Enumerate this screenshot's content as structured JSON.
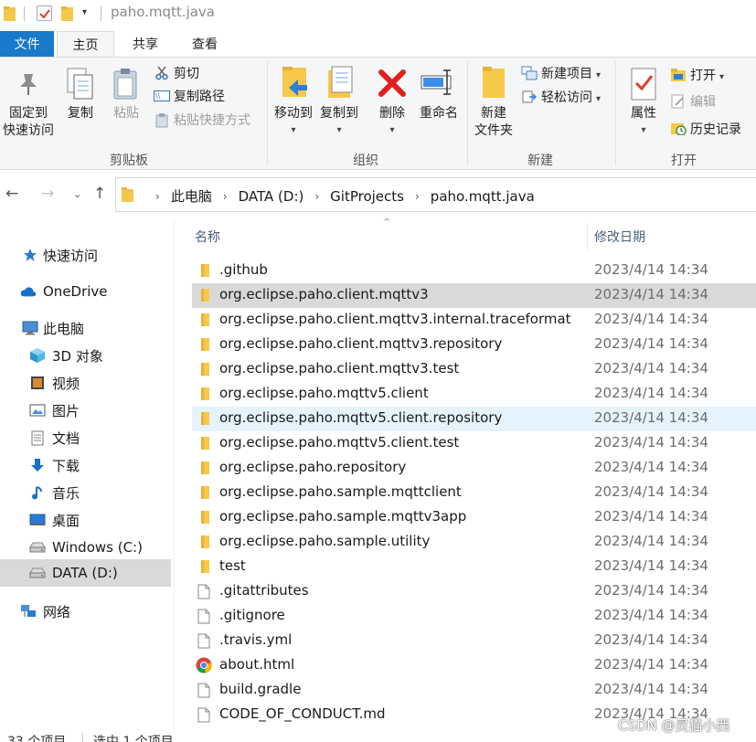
{
  "window": {
    "title": "paho.mqtt.java",
    "quick_access_dropdown": "▾"
  },
  "ribbon_tabs": {
    "file": "文件",
    "home": "主页",
    "share": "共享",
    "view": "查看"
  },
  "ribbon": {
    "clipboard": {
      "label": "剪贴板",
      "pin": "固定到\n快速访问",
      "pin_line1": "固定到",
      "pin_line2": "快速访问",
      "copy": "复制",
      "paste": "粘贴",
      "cut": "剪切",
      "copy_path": "复制路径",
      "paste_shortcut": "粘贴快捷方式"
    },
    "organize": {
      "label": "组织",
      "move_to": "移动到",
      "copy_to": "复制到",
      "delete": "删除",
      "rename": "重命名"
    },
    "new": {
      "label": "新建",
      "new_folder_line1": "新建",
      "new_folder_line2": "文件夹",
      "new_item": "新建项目",
      "easy_access": "轻松访问"
    },
    "open": {
      "label": "打开",
      "properties": "属性",
      "open": "打开",
      "edit": "编辑",
      "history": "历史记录"
    }
  },
  "address": {
    "crumbs": [
      "此电脑",
      "DATA (D:)",
      "GitProjects",
      "paho.mqtt.java"
    ]
  },
  "nav_pane": [
    {
      "label": "快速访问",
      "icon": "star-icon"
    },
    {
      "label": "OneDrive",
      "icon": "cloud-icon"
    },
    {
      "label": "此电脑",
      "icon": "computer-icon"
    },
    {
      "label": "3D 对象",
      "icon": "3d-objects-icon"
    },
    {
      "label": "视频",
      "icon": "video-icon"
    },
    {
      "label": "图片",
      "icon": "pictures-icon"
    },
    {
      "label": "文档",
      "icon": "documents-icon"
    },
    {
      "label": "下载",
      "icon": "download-icon"
    },
    {
      "label": "音乐",
      "icon": "music-icon"
    },
    {
      "label": "桌面",
      "icon": "desktop-icon"
    },
    {
      "label": "Windows (C:)",
      "icon": "drive-icon"
    },
    {
      "label": "DATA (D:)",
      "icon": "drive-icon"
    },
    {
      "label": "网络",
      "icon": "network-icon"
    }
  ],
  "columns": {
    "name": "名称",
    "date": "修改日期"
  },
  "files": [
    {
      "name": ".github",
      "date": "2023/4/14 14:34",
      "type": "folder"
    },
    {
      "name": "org.eclipse.paho.client.mqttv3",
      "date": "2023/4/14 14:34",
      "type": "folder",
      "state": "selected"
    },
    {
      "name": "org.eclipse.paho.client.mqttv3.internal.traceformat",
      "date": "2023/4/14 14:34",
      "type": "folder"
    },
    {
      "name": "org.eclipse.paho.client.mqttv3.repository",
      "date": "2023/4/14 14:34",
      "type": "folder"
    },
    {
      "name": "org.eclipse.paho.client.mqttv3.test",
      "date": "2023/4/14 14:34",
      "type": "folder"
    },
    {
      "name": "org.eclipse.paho.mqttv5.client",
      "date": "2023/4/14 14:34",
      "type": "folder"
    },
    {
      "name": "org.eclipse.paho.mqttv5.client.repository",
      "date": "2023/4/14 14:34",
      "type": "folder",
      "state": "hover"
    },
    {
      "name": "org.eclipse.paho.mqttv5.client.test",
      "date": "2023/4/14 14:34",
      "type": "folder"
    },
    {
      "name": "org.eclipse.paho.repository",
      "date": "2023/4/14 14:34",
      "type": "folder"
    },
    {
      "name": "org.eclipse.paho.sample.mqttclient",
      "date": "2023/4/14 14:34",
      "type": "folder"
    },
    {
      "name": "org.eclipse.paho.sample.mqttv3app",
      "date": "2023/4/14 14:34",
      "type": "folder"
    },
    {
      "name": "org.eclipse.paho.sample.utility",
      "date": "2023/4/14 14:34",
      "type": "folder"
    },
    {
      "name": "test",
      "date": "2023/4/14 14:34",
      "type": "folder"
    },
    {
      "name": ".gitattributes",
      "date": "2023/4/14 14:34",
      "type": "file"
    },
    {
      "name": ".gitignore",
      "date": "2023/4/14 14:34",
      "type": "file"
    },
    {
      "name": ".travis.yml",
      "date": "2023/4/14 14:34",
      "type": "file"
    },
    {
      "name": "about.html",
      "date": "2023/4/14 14:34",
      "type": "chrome"
    },
    {
      "name": "build.gradle",
      "date": "2023/4/14 14:34",
      "type": "file"
    },
    {
      "name": "CODE_OF_CONDUCT.md",
      "date": "2023/4/14 14:34",
      "type": "file"
    }
  ],
  "status": {
    "count": "33 个项目",
    "selected": "选中 1 个项目"
  },
  "watermark": "CSDN @灵猫小西",
  "colors": {
    "file_tab": "#1979ca",
    "selected_row": "#d9d9d9",
    "hover_row": "#e5f3ff",
    "folder": "#f8c948",
    "delete": "#e02020"
  }
}
